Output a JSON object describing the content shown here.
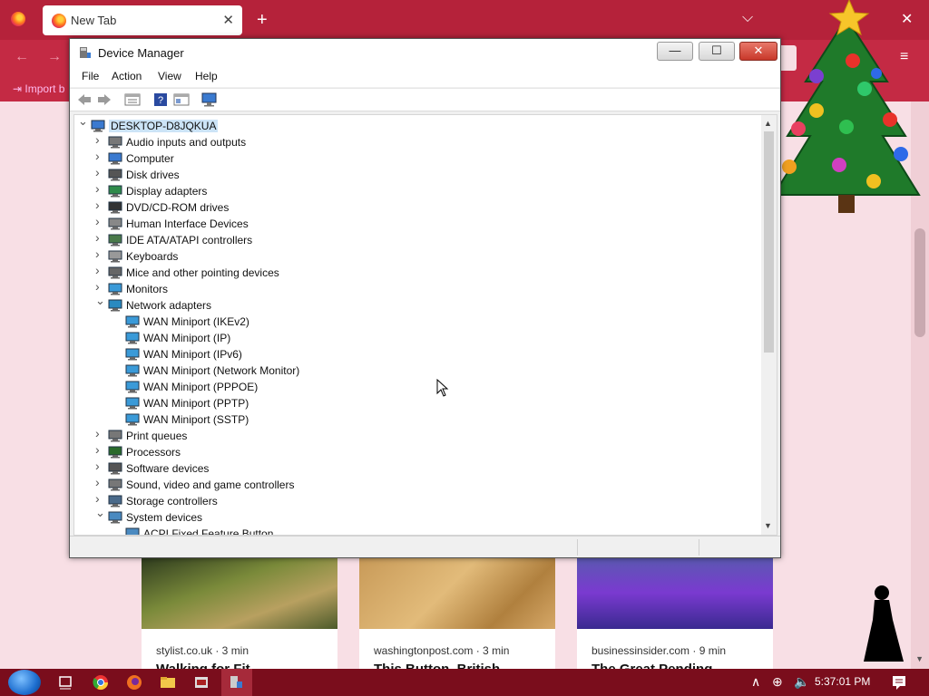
{
  "browser": {
    "tab_title": "New Tab",
    "bookmark_import": "Import b",
    "cards": [
      {
        "source": "stylist.co.uk · 3 min",
        "title": "Walking for Fit"
      },
      {
        "source": "washingtonpost.com · 3 min",
        "title": "This Button, British"
      },
      {
        "source": "businessinsider.com · 9 min",
        "title": "The Great Pending"
      }
    ]
  },
  "window": {
    "title": "Device Manager",
    "menu": [
      "File",
      "Action",
      "View",
      "Help"
    ]
  },
  "tree": {
    "root": "DESKTOP-D8JQKUA",
    "categories": [
      "Audio inputs and outputs",
      "Computer",
      "Disk drives",
      "Display adapters",
      "DVD/CD-ROM drives",
      "Human Interface Devices",
      "IDE ATA/ATAPI controllers",
      "Keyboards",
      "Mice and other pointing devices",
      "Monitors",
      "Network adapters",
      "Print queues",
      "Processors",
      "Software devices",
      "Sound, video and game controllers",
      "Storage controllers",
      "System devices"
    ],
    "network_adapters": [
      "WAN Miniport (IKEv2)",
      "WAN Miniport (IP)",
      "WAN Miniport (IPv6)",
      "WAN Miniport (Network Monitor)",
      "WAN Miniport (PPPOE)",
      "WAN Miniport (PPTP)",
      "WAN Miniport (SSTP)"
    ],
    "system_devices": [
      "ACPI Fixed Feature Button"
    ]
  },
  "taskbar": {
    "clock": "5:37:01 PM"
  },
  "colors": {
    "browser_accent": "#b5223a",
    "taskbar": "#7a0d1c",
    "selection": "#cce4f7"
  }
}
